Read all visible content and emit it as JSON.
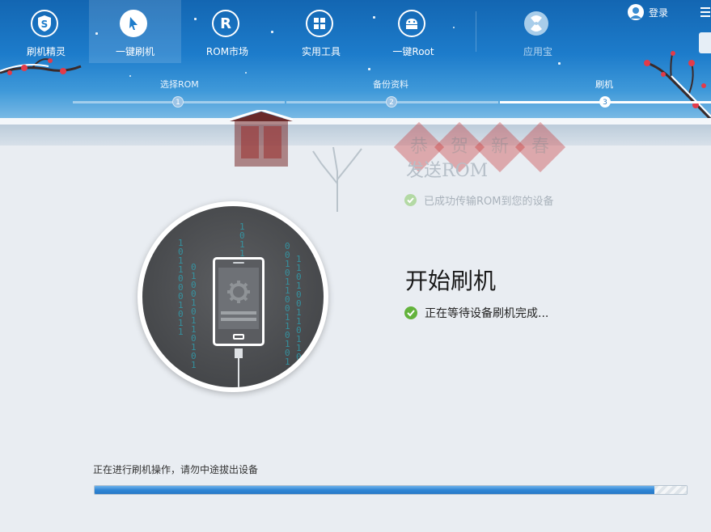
{
  "nav": {
    "items": [
      {
        "label": "刷机精灵",
        "icon": "shield-s-icon"
      },
      {
        "label": "一键刷机",
        "icon": "cursor-icon",
        "active": true
      },
      {
        "label": "ROM市场",
        "icon": "rom-r-icon"
      },
      {
        "label": "实用工具",
        "icon": "tools-grid-icon"
      },
      {
        "label": "一键Root",
        "icon": "android-root-icon"
      },
      {
        "label": "应用宝",
        "icon": "yingyongbao-icon"
      }
    ],
    "login": "登录"
  },
  "steps": [
    {
      "label": "选择ROM",
      "number": "1"
    },
    {
      "label": "备份资料",
      "number": "2"
    },
    {
      "label": "刷机",
      "number": "3",
      "active": true
    }
  ],
  "faded": {
    "title": "发送ROM",
    "check": "已成功传输ROM到您的设备",
    "banner": [
      "恭",
      "贺",
      "新",
      "春"
    ]
  },
  "main": {
    "title": "开始刷机",
    "status": "正在等待设备刷机完成..."
  },
  "footer": {
    "warning": "正在进行刷机操作，请勿中途拔出设备",
    "progress": 0.95
  },
  "colors": {
    "header": "#1d7ccb",
    "progress": "#2f86d6",
    "check": "#63b33c"
  }
}
